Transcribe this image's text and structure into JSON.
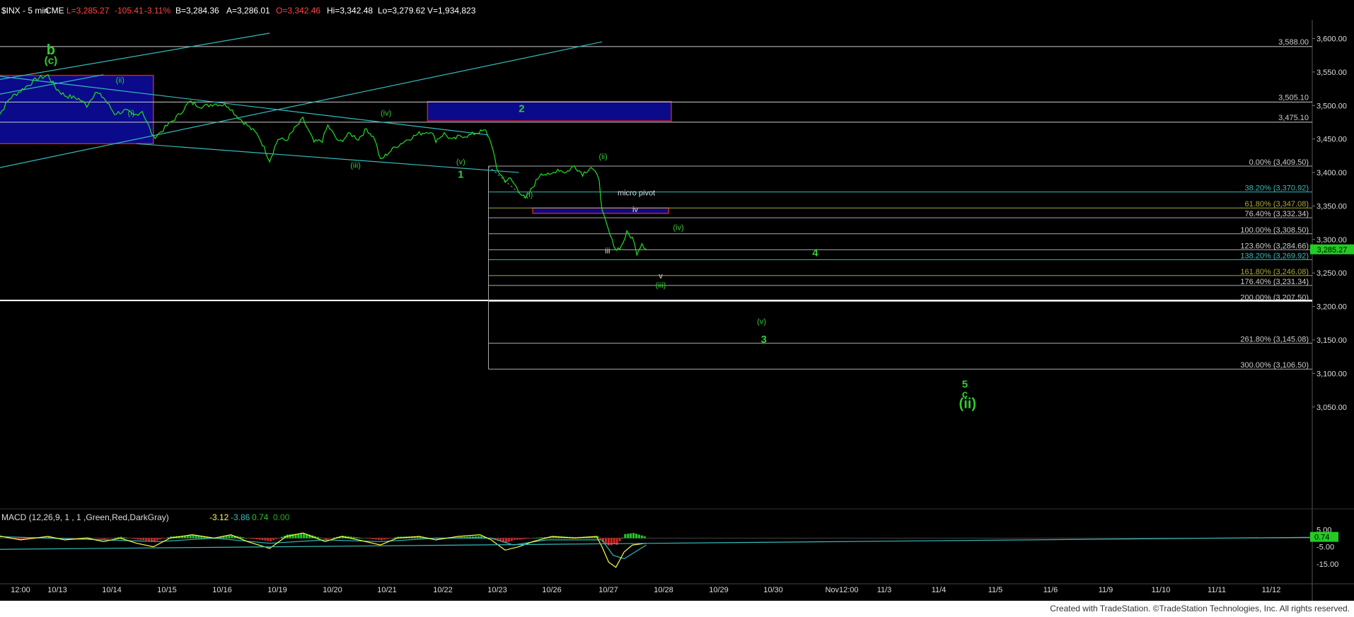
{
  "header": {
    "symbol": "$INX - 5 min",
    "exchange": "CME",
    "last": "L=3,285.27",
    "change": "-105.41",
    "change_pct": "-3.11%",
    "bid": "B=3,284.36",
    "ask": "A=3,286.01",
    "open": "O=3,342.46",
    "high": "Hi=3,342.48",
    "low": "Lo=3,279.62",
    "volume": "V=1,934,823"
  },
  "footer": {
    "text": "Created with TradeStation. ©TradeStation Technologies, Inc. All rights reserved."
  },
  "colors": {
    "price": "#22dd22",
    "box_fill": "#0a0a8a",
    "box_border": "#cc2222",
    "channel": "#33bbbb",
    "fib": "#aaaaaa",
    "axis_text": "#dddddd",
    "label_green": "#33cc33",
    "macd_line": "#ffff44",
    "signal_line": "#33bbbb",
    "hist_pos": "#22cc22",
    "hist_neg": "#dd2222",
    "last_price_badge": "#22cc22"
  },
  "chart_data": {
    "type": "line",
    "price_ylim": [
      3035,
      3610
    ],
    "y_ticks": [
      "3,600.00",
      "3,550.00",
      "3,500.00",
      "3,450.00",
      "3,400.00",
      "3,350.00",
      "3,300.00",
      "3,250.00",
      "3,200.00",
      "3,150.00",
      "3,100.00",
      "3,050.00"
    ],
    "x_ticks": [
      "12:00",
      "10/13",
      "10/14",
      "10/15",
      "10/16",
      "10/19",
      "10/20",
      "10/21",
      "10/22",
      "10/23",
      "10/26",
      "10/27",
      "10/28",
      "10/29",
      "10/30",
      "Nov12:00",
      "11/3",
      "11/4",
      "11/5",
      "11/6",
      "11/9",
      "11/10",
      "11/11",
      "11/12"
    ],
    "last_price": "3,285.27",
    "price_series": [
      {
        "t": -1.0,
        "v": 3470
      },
      {
        "t": -0.7,
        "v": 3510
      },
      {
        "t": -0.4,
        "v": 3528
      },
      {
        "t": -0.2,
        "v": 3540
      },
      {
        "t": 0.0,
        "v": 3545
      },
      {
        "t": 0.15,
        "v": 3525
      },
      {
        "t": 0.3,
        "v": 3515
      },
      {
        "t": 0.55,
        "v": 3510
      },
      {
        "t": 0.7,
        "v": 3500
      },
      {
        "t": 0.85,
        "v": 3520
      },
      {
        "t": 1.0,
        "v": 3512
      },
      {
        "t": 1.2,
        "v": 3488
      },
      {
        "t": 1.4,
        "v": 3492
      },
      {
        "t": 1.55,
        "v": 3485
      },
      {
        "t": 1.7,
        "v": 3492
      },
      {
        "t": 1.9,
        "v": 3452
      },
      {
        "t": 2.0,
        "v": 3458
      },
      {
        "t": 2.15,
        "v": 3470
      },
      {
        "t": 2.35,
        "v": 3485
      },
      {
        "t": 2.55,
        "v": 3505
      },
      {
        "t": 2.8,
        "v": 3498
      },
      {
        "t": 3.0,
        "v": 3503
      },
      {
        "t": 3.25,
        "v": 3500
      },
      {
        "t": 3.4,
        "v": 3485
      },
      {
        "t": 3.6,
        "v": 3470
      },
      {
        "t": 3.8,
        "v": 3455
      },
      {
        "t": 4.0,
        "v": 3418
      },
      {
        "t": 4.15,
        "v": 3450
      },
      {
        "t": 4.3,
        "v": 3448
      },
      {
        "t": 4.45,
        "v": 3465
      },
      {
        "t": 4.6,
        "v": 3480
      },
      {
        "t": 4.8,
        "v": 3445
      },
      {
        "t": 4.95,
        "v": 3448
      },
      {
        "t": 5.05,
        "v": 3470
      },
      {
        "t": 5.25,
        "v": 3445
      },
      {
        "t": 5.45,
        "v": 3458
      },
      {
        "t": 5.6,
        "v": 3450
      },
      {
        "t": 5.75,
        "v": 3465
      },
      {
        "t": 5.9,
        "v": 3450
      },
      {
        "t": 6.0,
        "v": 3418
      },
      {
        "t": 6.15,
        "v": 3430
      },
      {
        "t": 6.3,
        "v": 3440
      },
      {
        "t": 6.5,
        "v": 3450
      },
      {
        "t": 6.7,
        "v": 3458
      },
      {
        "t": 6.9,
        "v": 3462
      },
      {
        "t": 7.0,
        "v": 3448
      },
      {
        "t": 7.15,
        "v": 3458
      },
      {
        "t": 7.3,
        "v": 3448
      },
      {
        "t": 7.45,
        "v": 3455
      },
      {
        "t": 7.6,
        "v": 3455
      },
      {
        "t": 7.75,
        "v": 3460
      },
      {
        "t": 7.9,
        "v": 3462
      },
      {
        "t": 8.0,
        "v": 3445
      },
      {
        "t": 8.1,
        "v": 3405
      },
      {
        "t": 8.25,
        "v": 3388
      },
      {
        "t": 8.35,
        "v": 3390
      },
      {
        "t": 8.5,
        "v": 3373
      },
      {
        "t": 8.62,
        "v": 3360
      },
      {
        "t": 8.75,
        "v": 3378
      },
      {
        "t": 8.9,
        "v": 3400
      },
      {
        "t": 9.05,
        "v": 3395
      },
      {
        "t": 9.2,
        "v": 3405
      },
      {
        "t": 9.35,
        "v": 3400
      },
      {
        "t": 9.5,
        "v": 3410
      },
      {
        "t": 9.65,
        "v": 3398
      },
      {
        "t": 9.8,
        "v": 3408
      },
      {
        "t": 9.95,
        "v": 3390
      },
      {
        "t": 10.0,
        "v": 3342
      },
      {
        "t": 10.08,
        "v": 3322
      },
      {
        "t": 10.18,
        "v": 3298
      },
      {
        "t": 10.26,
        "v": 3285
      },
      {
        "t": 10.35,
        "v": 3290
      },
      {
        "t": 10.45,
        "v": 3310
      },
      {
        "t": 10.55,
        "v": 3302
      },
      {
        "t": 10.63,
        "v": 3280
      },
      {
        "t": 10.72,
        "v": 3295
      },
      {
        "t": 10.8,
        "v": 3285
      }
    ],
    "horizontal_levels": [
      {
        "value": 3588.0,
        "label": "3,588.00"
      },
      {
        "value": 3505.1,
        "label": "3,505.10"
      },
      {
        "value": 3475.1,
        "label": "3,475.10"
      }
    ],
    "fib_levels": [
      {
        "pct": "0.00%",
        "value": 3409.5,
        "label": "0.00% (3,409.50)",
        "color": "#aaaaaa"
      },
      {
        "pct": "38.20%",
        "value": 3370.92,
        "label": "38.20% (3,370.92)",
        "color": "#33bbbb"
      },
      {
        "pct": "61.80%",
        "value": 3347.08,
        "label": "61.80% (3,347.08)",
        "color": "#aaaa33"
      },
      {
        "pct": "76.40%",
        "value": 3332.34,
        "label": "76.40% (3,332.34)",
        "color": "#aaaaaa"
      },
      {
        "pct": "100.00%",
        "value": 3308.5,
        "label": "100.00% (3,308.50)",
        "color": "#aaaaaa"
      },
      {
        "pct": "123.60%",
        "value": 3284.66,
        "label": "123.60% (3,284.66)",
        "color": "#aaaaaa"
      },
      {
        "pct": "138.20%",
        "value": 3269.92,
        "label": "138.20% (3,269.92)",
        "color": "#33bbbb"
      },
      {
        "pct": "161.80%",
        "value": 3246.08,
        "label": "161.80% (3,246.08)",
        "color": "#aaaa33"
      },
      {
        "pct": "176.40%",
        "value": 3231.34,
        "label": "176.40% (3,231.34)",
        "color": "#aaaaaa"
      },
      {
        "pct": "200.00%",
        "value": 3207.5,
        "label": "200.00% (3,207.50)",
        "color": "#aaaaaa"
      },
      {
        "pct": "261.80%",
        "value": 3145.08,
        "label": "261.80% (3,145.08)",
        "color": "#aaaaaa"
      },
      {
        "pct": "300.00%",
        "value": 3106.5,
        "label": "300.00% (3,106.50)",
        "color": "#aaaaaa"
      }
    ],
    "wave_labels": [
      {
        "text": "b",
        "t": 0.05,
        "v": 3576,
        "size": "big"
      },
      {
        "text": "(c)",
        "t": 0.05,
        "v": 3562,
        "size": "mid"
      },
      {
        "text": "(ii)",
        "t": 1.3,
        "v": 3534,
        "size": "small"
      },
      {
        "text": "(i)",
        "t": 1.5,
        "v": 3485,
        "size": "small"
      },
      {
        "text": "(iv)",
        "t": 6.1,
        "v": 3485,
        "size": "small"
      },
      {
        "text": "(iii)",
        "t": 5.55,
        "v": 3407,
        "size": "small"
      },
      {
        "text": "(v)",
        "t": 7.45,
        "v": 3412,
        "size": "small"
      },
      {
        "text": "1",
        "t": 7.45,
        "v": 3392,
        "size": "mid"
      },
      {
        "text": "2",
        "t": 8.55,
        "v": 3490,
        "size": "mid"
      },
      {
        "text": "(ii)",
        "t": 10.02,
        "v": 3420,
        "size": "small"
      },
      {
        "text": "(i)",
        "t": 8.69,
        "v": 3363,
        "size": "small"
      },
      {
        "text": "micro pivot",
        "t": 10.62,
        "v": 3366,
        "size": "small",
        "color": "#dddddd"
      },
      {
        "text": "iv",
        "t": 10.6,
        "v": 3341,
        "size": "small",
        "color": "#dddddd"
      },
      {
        "text": "(iv)",
        "t": 11.38,
        "v": 3314,
        "size": "small"
      },
      {
        "text": "iii",
        "t": 10.1,
        "v": 3279,
        "size": "small",
        "color": "#dddddd"
      },
      {
        "text": "4",
        "t": 13.85,
        "v": 3275,
        "size": "mid"
      },
      {
        "text": "v",
        "t": 11.06,
        "v": 3242,
        "size": "small",
        "color": "#dddddd"
      },
      {
        "text": "(iii)",
        "t": 11.06,
        "v": 3228,
        "size": "small"
      },
      {
        "text": "(v)",
        "t": 12.88,
        "v": 3174,
        "size": "small"
      },
      {
        "text": "3",
        "t": 12.92,
        "v": 3146,
        "size": "mid"
      },
      {
        "text": "5",
        "t": 16.55,
        "v": 3079,
        "size": "mid"
      },
      {
        "text": "c",
        "t": 16.55,
        "v": 3064,
        "size": "mid"
      },
      {
        "text": "(ii)",
        "t": 16.6,
        "v": 3048,
        "size": "big"
      }
    ],
    "macd": {
      "label": "MACD (12,26,9, 1 , 1 ,Green,Red,DarkGray)",
      "values": [
        "-3.12",
        "-3.86",
        "0.74",
        "0.00"
      ],
      "value_colors": [
        "#ffff44",
        "#33bbbb",
        "#22cc22",
        "#22aa22"
      ],
      "ylim": [
        -20,
        8
      ],
      "y_ticks": [
        "5.00",
        "-5.00",
        "-15.00"
      ],
      "last": "0.74",
      "macd_line": [
        {
          "t": -1.0,
          "v": 2
        },
        {
          "t": -0.5,
          "v": -1
        },
        {
          "t": 0.0,
          "v": 1
        },
        {
          "t": 0.3,
          "v": -1
        },
        {
          "t": 0.7,
          "v": 0
        },
        {
          "t": 1.0,
          "v": -2
        },
        {
          "t": 1.3,
          "v": 0
        },
        {
          "t": 1.6,
          "v": -3
        },
        {
          "t": 1.9,
          "v": -5
        },
        {
          "t": 2.2,
          "v": 0
        },
        {
          "t": 2.6,
          "v": 2
        },
        {
          "t": 3.0,
          "v": 0
        },
        {
          "t": 3.3,
          "v": 2
        },
        {
          "t": 3.6,
          "v": -2
        },
        {
          "t": 4.0,
          "v": -6
        },
        {
          "t": 4.3,
          "v": 1
        },
        {
          "t": 4.6,
          "v": 3
        },
        {
          "t": 5.0,
          "v": -2
        },
        {
          "t": 5.3,
          "v": 1
        },
        {
          "t": 5.6,
          "v": -1
        },
        {
          "t": 6.0,
          "v": -4
        },
        {
          "t": 6.3,
          "v": 0
        },
        {
          "t": 6.7,
          "v": 1
        },
        {
          "t": 7.0,
          "v": -1
        },
        {
          "t": 7.4,
          "v": 1
        },
        {
          "t": 7.8,
          "v": 2
        },
        {
          "t": 8.0,
          "v": -1
        },
        {
          "t": 8.25,
          "v": -7
        },
        {
          "t": 8.5,
          "v": -5
        },
        {
          "t": 8.75,
          "v": -2
        },
        {
          "t": 9.1,
          "v": 1
        },
        {
          "t": 9.5,
          "v": 0
        },
        {
          "t": 9.9,
          "v": 1
        },
        {
          "t": 10.0,
          "v": -5
        },
        {
          "t": 10.12,
          "v": -14
        },
        {
          "t": 10.25,
          "v": -17
        },
        {
          "t": 10.4,
          "v": -8
        },
        {
          "t": 10.55,
          "v": -4
        },
        {
          "t": 10.8,
          "v": -3
        }
      ],
      "signal_line": [
        {
          "t": -1.0,
          "v": 1
        },
        {
          "t": 0.0,
          "v": 0
        },
        {
          "t": 1.0,
          "v": -1
        },
        {
          "t": 2.0,
          "v": -2
        },
        {
          "t": 3.0,
          "v": 0
        },
        {
          "t": 4.0,
          "v": -3
        },
        {
          "t": 5.0,
          "v": -1
        },
        {
          "t": 6.0,
          "v": -2
        },
        {
          "t": 7.0,
          "v": 0
        },
        {
          "t": 8.0,
          "v": 0
        },
        {
          "t": 8.4,
          "v": -4
        },
        {
          "t": 9.0,
          "v": -1
        },
        {
          "t": 10.0,
          "v": -1
        },
        {
          "t": 10.2,
          "v": -10
        },
        {
          "t": 10.4,
          "v": -12
        },
        {
          "t": 10.8,
          "v": -4
        }
      ]
    }
  }
}
